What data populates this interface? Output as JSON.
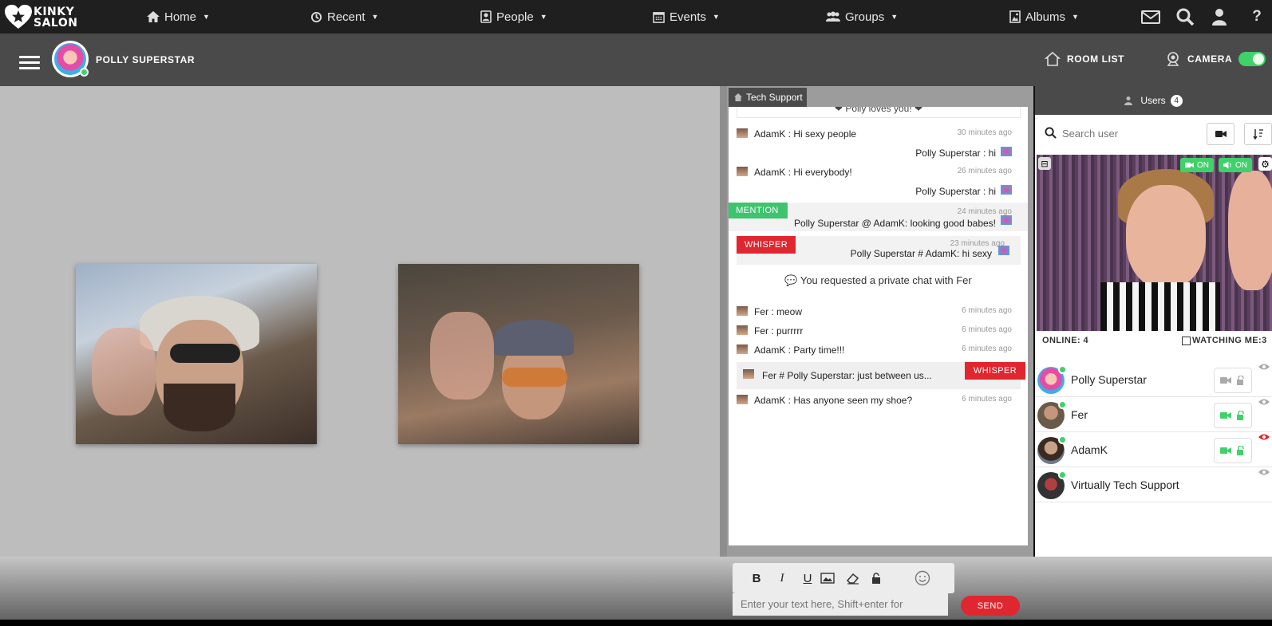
{
  "brand": {
    "logo_text": "KINKY\nSALON"
  },
  "topnav": {
    "items": [
      {
        "label": "Home",
        "icon": "home-icon"
      },
      {
        "label": "Recent",
        "icon": "history-icon"
      },
      {
        "label": "People",
        "icon": "people-icon"
      },
      {
        "label": "Events",
        "icon": "calendar-icon"
      },
      {
        "label": "Groups",
        "icon": "groups-icon"
      },
      {
        "label": "Albums",
        "icon": "image-icon"
      }
    ],
    "right_icons": [
      "mail-icon",
      "search-icon",
      "user-icon",
      "help-icon"
    ],
    "help_glyph": "?"
  },
  "subbar": {
    "username": "POLLY SUPERSTAR",
    "room_list": "ROOM LIST",
    "camera": "CAMERA",
    "camera_on": true
  },
  "chat": {
    "tab": "Tech Support",
    "banner": "Polly loves you!",
    "messages": [
      {
        "from": "AdamK : Hi sexy people",
        "time": "30 minutes ago"
      },
      {
        "reply": "Polly Superstar : hi"
      },
      {
        "from": "AdamK : Hi everybody!",
        "time": "26 minutes ago"
      },
      {
        "reply": "Polly Superstar : hi"
      },
      {
        "tag": "MENTION",
        "text": "Polly Superstar @ AdamK: looking good babes!",
        "time": "24 minutes ago"
      },
      {
        "tag": "WHISPER",
        "text": "Polly Superstar # AdamK: hi sexy",
        "time": "23 minutes ago"
      },
      {
        "system": "You requested a private chat with Fer"
      },
      {
        "from": "Fer : meow",
        "time": "6 minutes ago"
      },
      {
        "from": "Fer : purrrrr",
        "time": "6 minutes ago"
      },
      {
        "from": "AdamK : Party time!!!",
        "time": "6 minutes ago"
      },
      {
        "text": "Fer # Polly Superstar: just between us...",
        "tag": "WHISPER"
      },
      {
        "from": "AdamK : Has anyone seen my shoe?",
        "time": "6 minutes ago"
      }
    ],
    "toolbar": [
      "B",
      "I",
      "U"
    ],
    "input_placeholder": "Enter your text here, Shift+enter for",
    "send_label": "SEND",
    "colors": {
      "mention": "#3fc46e",
      "whisper": "#e0262f"
    }
  },
  "users": {
    "header": "Users",
    "count": "4",
    "search_placeholder": "Search user",
    "video_badges": [
      "ON",
      "ON"
    ],
    "online": "ONLINE: 4",
    "watching": "WATCHING ME:3",
    "list": [
      {
        "name": "Polly Superstar"
      },
      {
        "name": "Fer"
      },
      {
        "name": "AdamK"
      },
      {
        "name": "Virtually Tech Support"
      }
    ]
  },
  "colors": {
    "nav_bg": "#1f1f1f",
    "sub_bg": "#4a4a4a",
    "accent_green": "#3fd16a",
    "accent_red": "#e0262f"
  }
}
